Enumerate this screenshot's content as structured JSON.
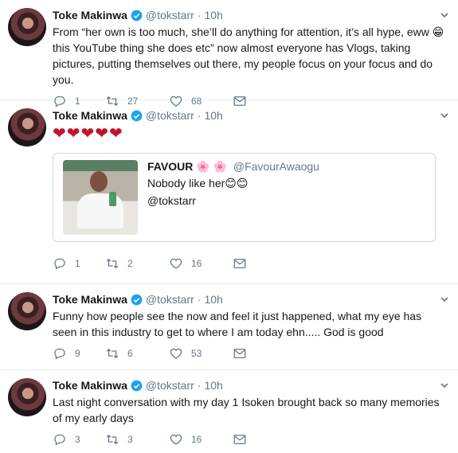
{
  "tweets": [
    {
      "name": "Toke Makinwa",
      "handle": "@tokstarr",
      "dot": "·",
      "time": "10h",
      "text": "From “her own is too much, she’ll do anything for attention, it’s all hype, eww 😁 this YouTube thing she does etc” now almost everyone has Vlogs, taking pictures, putting themselves out there, my people focus on your focus and do you.",
      "replies": "1",
      "retweets": "27",
      "likes": "68"
    },
    {
      "name": "Toke Makinwa",
      "handle": "@tokstarr",
      "dot": "·",
      "time": "10h",
      "text": "❤❤❤❤❤",
      "quote": {
        "name": "FAVOUR",
        "flowers": "🌸 🌸",
        "handle": "@FavourAwaogu",
        "line1": "Nobody like her😊😊",
        "line2": "@tokstarr"
      },
      "replies": "1",
      "retweets": "2",
      "likes": "16"
    },
    {
      "name": "Toke Makinwa",
      "handle": "@tokstarr",
      "dot": "·",
      "time": "10h",
      "text": "Funny how people see the now and feel it just happened, what my eye has seen in this industry to get to where I am today ehn..... God is good",
      "replies": "9",
      "retweets": "6",
      "likes": "53"
    },
    {
      "name": "Toke Makinwa",
      "handle": "@tokstarr",
      "dot": "·",
      "time": "10h",
      "text": "Last night conversation with my day 1 Isoken brought back so many memories of my early days",
      "replies": "3",
      "retweets": "3",
      "likes": "16"
    }
  ],
  "colors": {
    "verified": "#1da1f2",
    "icon": "#657786",
    "heart": "#c0152b"
  },
  "icons": [
    "verified-badge-icon",
    "caret-down-icon",
    "reply-icon",
    "retweet-icon",
    "like-icon",
    "message-icon"
  ]
}
